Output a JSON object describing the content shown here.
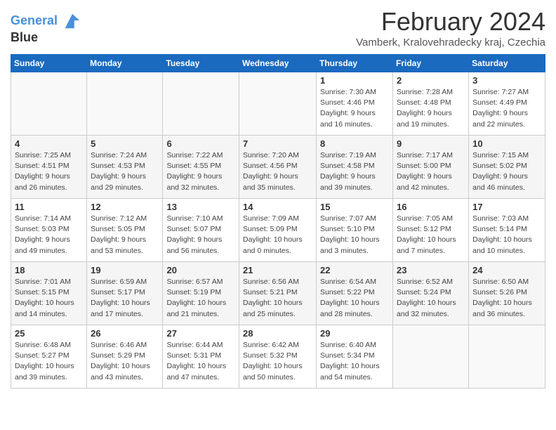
{
  "header": {
    "logo_line1": "General",
    "logo_line2": "Blue",
    "title": "February 2024",
    "subtitle": "Vamberk, Kralovehradecky kraj, Czechia"
  },
  "days_of_week": [
    "Sunday",
    "Monday",
    "Tuesday",
    "Wednesday",
    "Thursday",
    "Friday",
    "Saturday"
  ],
  "weeks": [
    [
      {
        "day": "",
        "info": ""
      },
      {
        "day": "",
        "info": ""
      },
      {
        "day": "",
        "info": ""
      },
      {
        "day": "",
        "info": ""
      },
      {
        "day": "1",
        "info": "Sunrise: 7:30 AM\nSunset: 4:46 PM\nDaylight: 9 hours\nand 16 minutes."
      },
      {
        "day": "2",
        "info": "Sunrise: 7:28 AM\nSunset: 4:48 PM\nDaylight: 9 hours\nand 19 minutes."
      },
      {
        "day": "3",
        "info": "Sunrise: 7:27 AM\nSunset: 4:49 PM\nDaylight: 9 hours\nand 22 minutes."
      }
    ],
    [
      {
        "day": "4",
        "info": "Sunrise: 7:25 AM\nSunset: 4:51 PM\nDaylight: 9 hours\nand 26 minutes."
      },
      {
        "day": "5",
        "info": "Sunrise: 7:24 AM\nSunset: 4:53 PM\nDaylight: 9 hours\nand 29 minutes."
      },
      {
        "day": "6",
        "info": "Sunrise: 7:22 AM\nSunset: 4:55 PM\nDaylight: 9 hours\nand 32 minutes."
      },
      {
        "day": "7",
        "info": "Sunrise: 7:20 AM\nSunset: 4:56 PM\nDaylight: 9 hours\nand 35 minutes."
      },
      {
        "day": "8",
        "info": "Sunrise: 7:19 AM\nSunset: 4:58 PM\nDaylight: 9 hours\nand 39 minutes."
      },
      {
        "day": "9",
        "info": "Sunrise: 7:17 AM\nSunset: 5:00 PM\nDaylight: 9 hours\nand 42 minutes."
      },
      {
        "day": "10",
        "info": "Sunrise: 7:15 AM\nSunset: 5:02 PM\nDaylight: 9 hours\nand 46 minutes."
      }
    ],
    [
      {
        "day": "11",
        "info": "Sunrise: 7:14 AM\nSunset: 5:03 PM\nDaylight: 9 hours\nand 49 minutes."
      },
      {
        "day": "12",
        "info": "Sunrise: 7:12 AM\nSunset: 5:05 PM\nDaylight: 9 hours\nand 53 minutes."
      },
      {
        "day": "13",
        "info": "Sunrise: 7:10 AM\nSunset: 5:07 PM\nDaylight: 9 hours\nand 56 minutes."
      },
      {
        "day": "14",
        "info": "Sunrise: 7:09 AM\nSunset: 5:09 PM\nDaylight: 10 hours\nand 0 minutes."
      },
      {
        "day": "15",
        "info": "Sunrise: 7:07 AM\nSunset: 5:10 PM\nDaylight: 10 hours\nand 3 minutes."
      },
      {
        "day": "16",
        "info": "Sunrise: 7:05 AM\nSunset: 5:12 PM\nDaylight: 10 hours\nand 7 minutes."
      },
      {
        "day": "17",
        "info": "Sunrise: 7:03 AM\nSunset: 5:14 PM\nDaylight: 10 hours\nand 10 minutes."
      }
    ],
    [
      {
        "day": "18",
        "info": "Sunrise: 7:01 AM\nSunset: 5:15 PM\nDaylight: 10 hours\nand 14 minutes."
      },
      {
        "day": "19",
        "info": "Sunrise: 6:59 AM\nSunset: 5:17 PM\nDaylight: 10 hours\nand 17 minutes."
      },
      {
        "day": "20",
        "info": "Sunrise: 6:57 AM\nSunset: 5:19 PM\nDaylight: 10 hours\nand 21 minutes."
      },
      {
        "day": "21",
        "info": "Sunrise: 6:56 AM\nSunset: 5:21 PM\nDaylight: 10 hours\nand 25 minutes."
      },
      {
        "day": "22",
        "info": "Sunrise: 6:54 AM\nSunset: 5:22 PM\nDaylight: 10 hours\nand 28 minutes."
      },
      {
        "day": "23",
        "info": "Sunrise: 6:52 AM\nSunset: 5:24 PM\nDaylight: 10 hours\nand 32 minutes."
      },
      {
        "day": "24",
        "info": "Sunrise: 6:50 AM\nSunset: 5:26 PM\nDaylight: 10 hours\nand 36 minutes."
      }
    ],
    [
      {
        "day": "25",
        "info": "Sunrise: 6:48 AM\nSunset: 5:27 PM\nDaylight: 10 hours\nand 39 minutes."
      },
      {
        "day": "26",
        "info": "Sunrise: 6:46 AM\nSunset: 5:29 PM\nDaylight: 10 hours\nand 43 minutes."
      },
      {
        "day": "27",
        "info": "Sunrise: 6:44 AM\nSunset: 5:31 PM\nDaylight: 10 hours\nand 47 minutes."
      },
      {
        "day": "28",
        "info": "Sunrise: 6:42 AM\nSunset: 5:32 PM\nDaylight: 10 hours\nand 50 minutes."
      },
      {
        "day": "29",
        "info": "Sunrise: 6:40 AM\nSunset: 5:34 PM\nDaylight: 10 hours\nand 54 minutes."
      },
      {
        "day": "",
        "info": ""
      },
      {
        "day": "",
        "info": ""
      }
    ]
  ]
}
